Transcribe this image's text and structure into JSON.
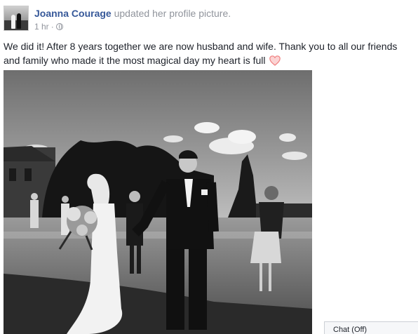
{
  "post": {
    "author": "Joanna Courage",
    "action": "updated her profile picture.",
    "time": "1 hr",
    "separator": "·",
    "privacy_icon": "globe-icon",
    "text": "We did it! After 8 years together we are now husband and wife. Thank you to all our friends and family who made it the most magical day my heart is full",
    "emoji": "heart-icon",
    "photo": "black-and-white wedding photo"
  },
  "chat": {
    "label": "Chat (Off)"
  },
  "colors": {
    "author_link": "#365899",
    "secondary_text": "#90949c",
    "heart": "#f08080"
  }
}
